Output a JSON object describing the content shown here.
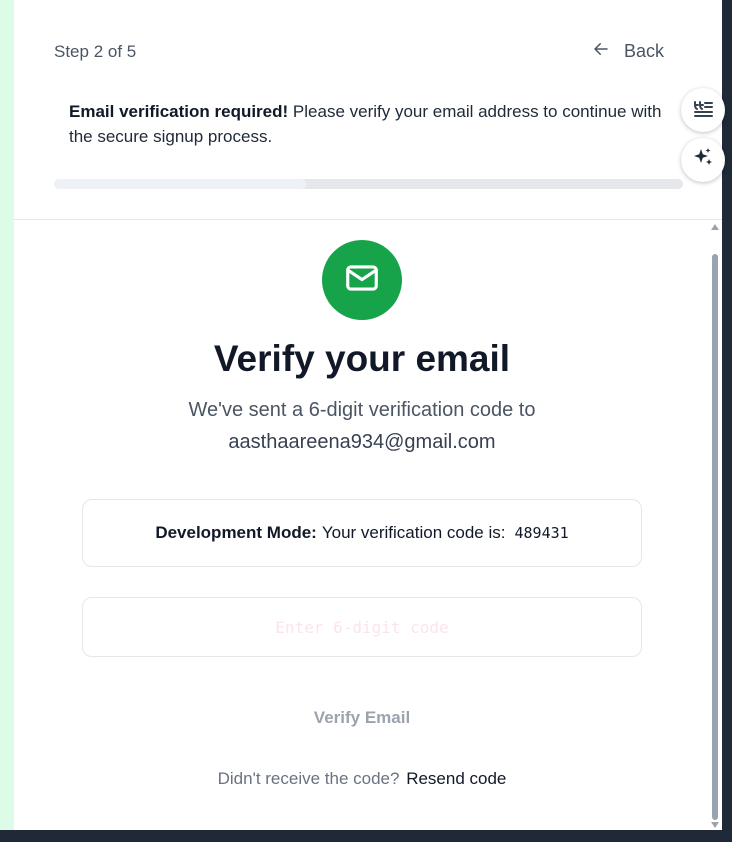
{
  "header": {
    "step_text": "Step 2 of 5",
    "back_label": "Back",
    "progress_fraction": 0.4
  },
  "notice": {
    "bold": "Email verification required!",
    "text": "Please verify your email address to continue with the secure signup process."
  },
  "main": {
    "icon": "mail-icon",
    "title": "Verify your email",
    "subtitle": "We've sent a 6-digit verification code to",
    "email": "aasthaareena934@gmail.com"
  },
  "dev_box": {
    "label": "Development Mode:",
    "text": "Your verification code is:",
    "code": "489431"
  },
  "code_input": {
    "value": "",
    "placeholder": "Enter 6-digit code"
  },
  "verify_label": "Verify Email",
  "resend": {
    "prompt": "Didn't receive the code?",
    "link": "Resend code"
  },
  "floating_buttons": [
    "quote-icon",
    "sparkle-icon"
  ],
  "colors": {
    "accent_green": "#16a34a",
    "text_dark": "#111827",
    "text_muted": "#4b5563",
    "border": "#e5e7eb"
  }
}
